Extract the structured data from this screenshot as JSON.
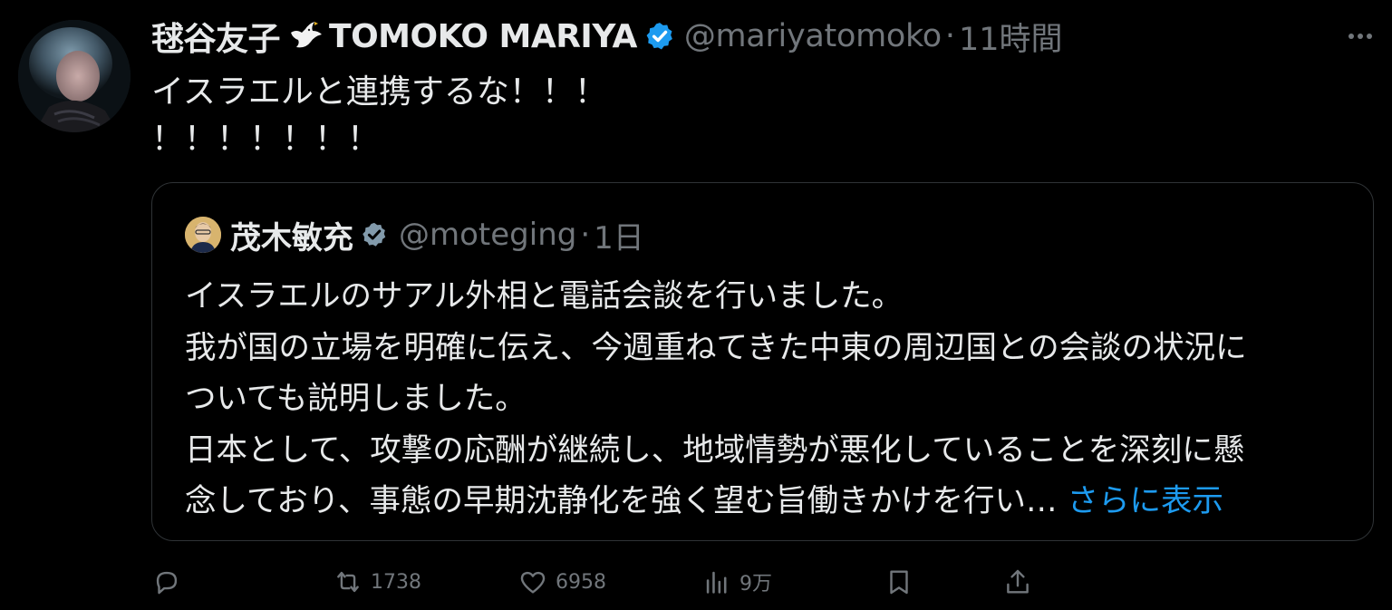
{
  "tweet": {
    "display_name": "毬谷友子",
    "display_name_latin": "TOMOKO MARIYA",
    "handle": "@mariyatomoko",
    "separator": "·",
    "time": "11時間",
    "text_line1": "イスラエルと連携するな！！！",
    "text_line2": "！！！！！！！"
  },
  "quote": {
    "display_name": "茂木敏充",
    "handle": "@moteging",
    "separator": "·",
    "time": "1日",
    "lines": [
      "イスラエルのサアル外相と電話会談を行いました。",
      "我が国の立場を明確に伝え、今週重ねてきた中東の周辺国との会談の状況に",
      "ついても説明しました。",
      "日本として、攻撃の応酬が継続し、地域情勢が悪化していることを深刻に懸",
      "念しており、事態の早期沈静化を強く望む旨働きかけを行い…"
    ],
    "show_more_label": "さらに表示"
  },
  "actions": {
    "reply_count": "",
    "retweet_count": "1738",
    "like_count": "6958",
    "views_count": "9万"
  },
  "icons": {
    "verified": "verified-badge-icon",
    "dove": "dove-icon",
    "more": "more-icon",
    "reply": "reply-icon",
    "retweet": "retweet-icon",
    "like": "heart-icon",
    "views": "views-icon",
    "bookmark": "bookmark-icon",
    "share": "share-icon"
  },
  "colors": {
    "background": "#000000",
    "text": "#e7e9ea",
    "secondary": "#71767b",
    "accent": "#1d9bf0",
    "border": "#2f3336"
  }
}
